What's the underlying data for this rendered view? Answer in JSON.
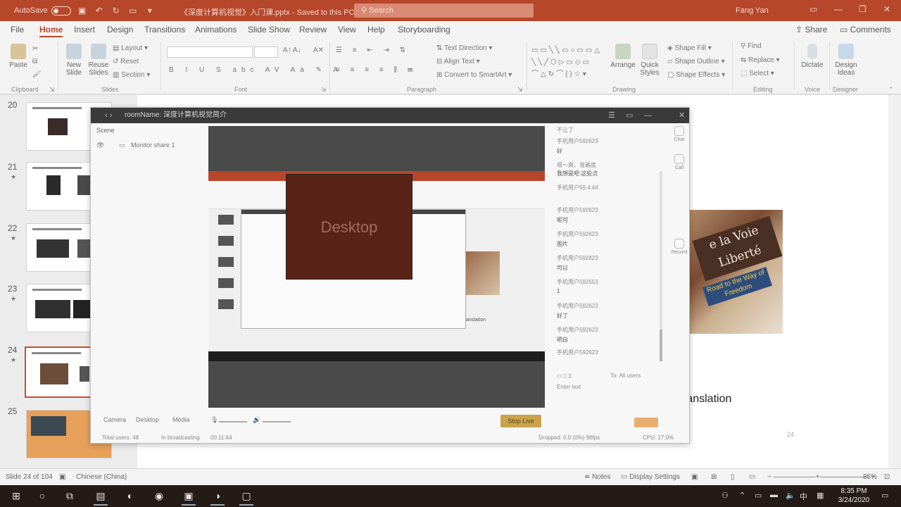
{
  "titlebar": {
    "autosave": "AutoSave",
    "toggle_state": "Off",
    "document_title": "《深度计算机视觉》入门课.pptx - Saved to this PC",
    "search_placeholder": "Search",
    "user": "Fang Yan"
  },
  "ribbon": {
    "tabs": [
      "File",
      "Home",
      "Insert",
      "Design",
      "Transitions",
      "Animations",
      "Slide Show",
      "Review",
      "View",
      "Help",
      "Storyboarding"
    ],
    "share": "Share",
    "comments": "Comments",
    "clipboard": {
      "paste": "Paste",
      "label": "Clipboard"
    },
    "slides": {
      "new_slide": "New Slide",
      "reuse_slides": "Reuse Slides",
      "layout": "Layout",
      "reset": "Reset",
      "section": "Section",
      "label": "Slides"
    },
    "font_label": "Font",
    "paragraph": {
      "text_direction": "Text Direction",
      "align_text": "Align Text",
      "convert": "Convert to SmartArt",
      "label": "Paragraph"
    },
    "drawing": {
      "arrange": "Arrange",
      "quick_styles": "Quick Styles",
      "shape_fill": "Shape Fill",
      "shape_outline": "Shape Outline",
      "shape_effects": "Shape Effects",
      "label": "Drawing"
    },
    "editing": {
      "find": "Find",
      "replace": "Replace",
      "select": "Select",
      "label": "Editing"
    },
    "voice": {
      "dictate": "Dictate",
      "label": "Voice"
    },
    "designer": {
      "design_ideas": "Design Ideas",
      "label": "Designer"
    }
  },
  "thumbnails": [
    {
      "num": "20",
      "star": false
    },
    {
      "num": "21",
      "star": true
    },
    {
      "num": "22",
      "star": true
    },
    {
      "num": "23",
      "star": true
    },
    {
      "num": "24",
      "star": true
    },
    {
      "num": "25",
      "star": false
    }
  ],
  "slide": {
    "sign_text": "e la Voie Liberté",
    "sign2_text": "Road to the Way of Freedom",
    "text": "ranslation",
    "slide_number": "24"
  },
  "meeting": {
    "title": "roomName: 深度计算机视觉简介",
    "scene_label": "Scene",
    "scene_item": "Monitor share 1",
    "desktop_label": "Desktop",
    "inner_translation": "anslation",
    "chat_lines": [
      "不让了",
      "手机用户592623",
      "好",
      "嗯～爽、准确度",
      "我想是吧 这些点",
      "手机用户59.4.44",
      "手机用户592623",
      "呢可",
      "手机用户592623",
      "图片",
      "手机用户592823",
      "可以",
      "手机用户592553",
      "1",
      "手机用户592623",
      "好了",
      "手机用户592623",
      "明白",
      "手机用户592623"
    ],
    "chat_input_hint": "To: All users",
    "chat_footer": "Enter text",
    "side_buttons": [
      "Chat",
      "Call",
      "Record"
    ],
    "sources": [
      "Camera",
      "Desktop",
      "Media"
    ],
    "go_live": "Stop Live",
    "status_users": "Total users: 48",
    "status_broadcast": "In broadcasting",
    "status_time": "00:11:44",
    "status_dropped": "Dropped: 0.0 (0%)  90fps",
    "status_cpu": "CPU: 17.0%"
  },
  "statusbar": {
    "slide_of": "Slide 24 of 104",
    "language": "Chinese (China)",
    "notes": "Notes",
    "display_settings": "Display Settings",
    "zoom": "85%"
  },
  "taskbar": {
    "time": "8:35 PM",
    "date": "3/24/2020",
    "ime": "中"
  }
}
